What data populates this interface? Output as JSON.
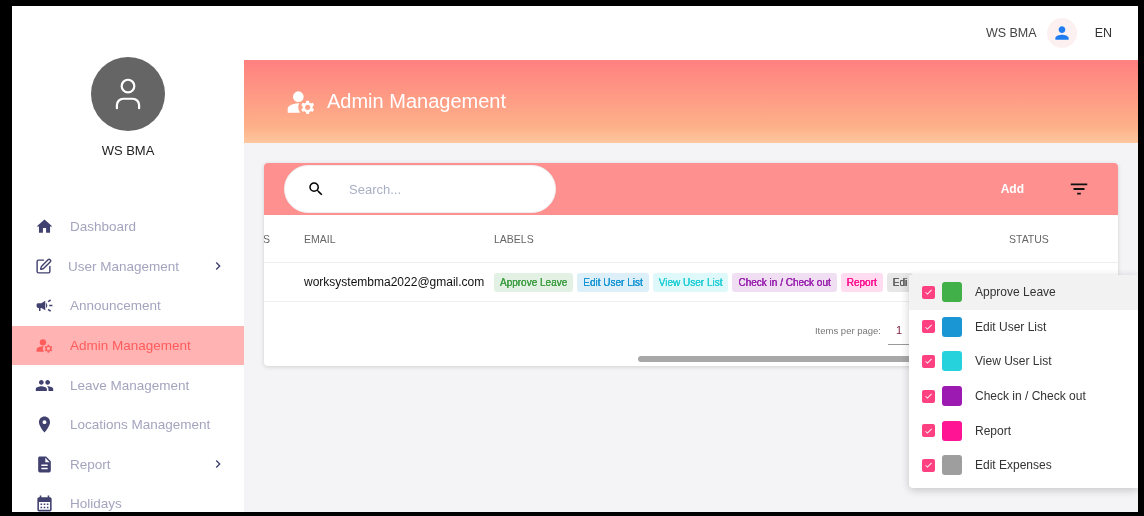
{
  "topbar": {
    "user_name": "WS BMA",
    "language": "EN"
  },
  "sidebar": {
    "profile_name": "WS BMA",
    "items": [
      {
        "label": "Dashboard",
        "expandable": false,
        "selected": false
      },
      {
        "label": "User Management",
        "expandable": true,
        "selected": false
      },
      {
        "label": "Announcement",
        "expandable": false,
        "selected": false
      },
      {
        "label": "Admin Management",
        "expandable": false,
        "selected": true
      },
      {
        "label": "Leave Management",
        "expandable": false,
        "selected": false
      },
      {
        "label": "Locations Management",
        "expandable": false,
        "selected": false
      },
      {
        "label": "Report",
        "expandable": true,
        "selected": false
      },
      {
        "label": "Holidays",
        "expandable": false,
        "selected": false
      }
    ]
  },
  "page_header": {
    "title": "Admin Management"
  },
  "toolbar": {
    "search": {
      "placeholder": "Search..."
    },
    "add_button": "Add"
  },
  "table": {
    "columns": [
      "S",
      "EMAIL",
      "LABELS",
      "STATUS"
    ],
    "rows": [
      {
        "email": "worksystembma2022@gmail.com",
        "labels": [
          {
            "text": "Approve Leave",
            "color": "#43a047"
          },
          {
            "text": "Edit User List",
            "color": "#1a96d4"
          },
          {
            "text": "View User List",
            "color": "#26cfd8"
          },
          {
            "text": "Check in / Check out",
            "color": "#9c27b0"
          },
          {
            "text": "Report",
            "color": "#ff1493"
          },
          {
            "text": "Edi",
            "color": "#616161"
          }
        ]
      }
    ],
    "paginator": {
      "label": "Items per page:",
      "value": "1"
    }
  },
  "label_menu": {
    "items": [
      {
        "label": "Approve Leave",
        "color": "#41b048",
        "checked": true,
        "selected": true
      },
      {
        "label": "Edit User List",
        "color": "#1a96d4",
        "checked": true,
        "selected": false
      },
      {
        "label": "View User List",
        "color": "#26d3dd",
        "checked": true,
        "selected": false
      },
      {
        "label": "Check in / Check out",
        "color": "#9c1ab1",
        "checked": true,
        "selected": false
      },
      {
        "label": "Report",
        "color": "#ff1493",
        "checked": true,
        "selected": false
      },
      {
        "label": "Edit Expenses",
        "color": "#9e9e9e",
        "checked": true,
        "selected": false
      }
    ]
  }
}
